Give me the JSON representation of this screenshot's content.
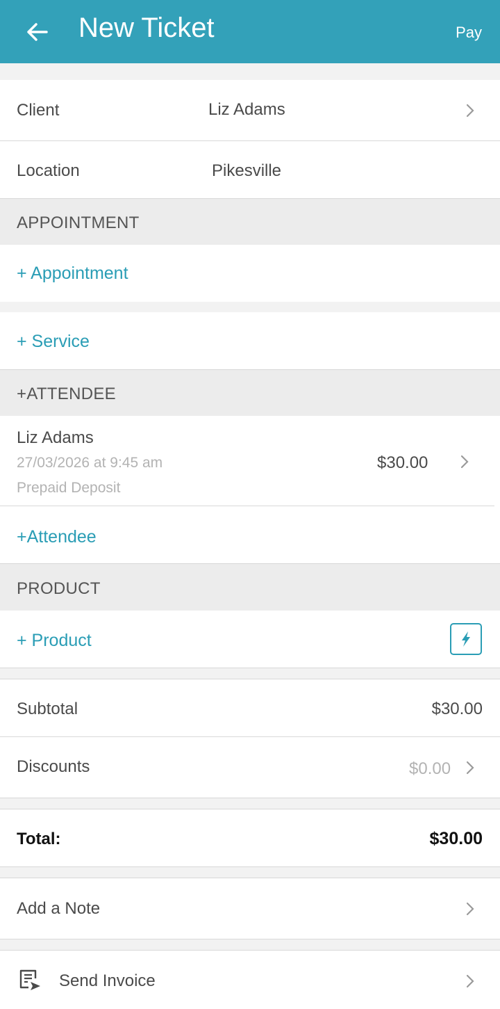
{
  "header": {
    "title": "New Ticket",
    "pay_label": "Pay"
  },
  "client": {
    "label": "Client",
    "value": "Liz Adams"
  },
  "location": {
    "label": "Location",
    "value": "Pikesville"
  },
  "appointment": {
    "section_title": "APPOINTMENT",
    "add_label": "+ Appointment"
  },
  "service": {
    "add_label": "+ Service"
  },
  "attendee": {
    "section_title": "+ATTENDEE",
    "item": {
      "name": "Liz Adams",
      "datetime": "27/03/2026 at 9:45 am",
      "type": "Prepaid Deposit",
      "amount": "$30.00"
    },
    "add_label": "+Attendee"
  },
  "product": {
    "section_title": "PRODUCT",
    "add_label": "+ Product",
    "quick_icon": "lightning-icon"
  },
  "totals": {
    "subtotal_label": "Subtotal",
    "subtotal_value": "$30.00",
    "discounts_label": "Discounts",
    "discounts_value": "$0.00",
    "total_label": "Total:",
    "total_value": "$30.00"
  },
  "note": {
    "label": "Add a Note"
  },
  "invoice": {
    "label": "Send Invoice",
    "icon": "invoice-icon"
  },
  "colors": {
    "accent": "#33a1b9",
    "link": "#2a9db5",
    "section_bg": "#ececec"
  }
}
